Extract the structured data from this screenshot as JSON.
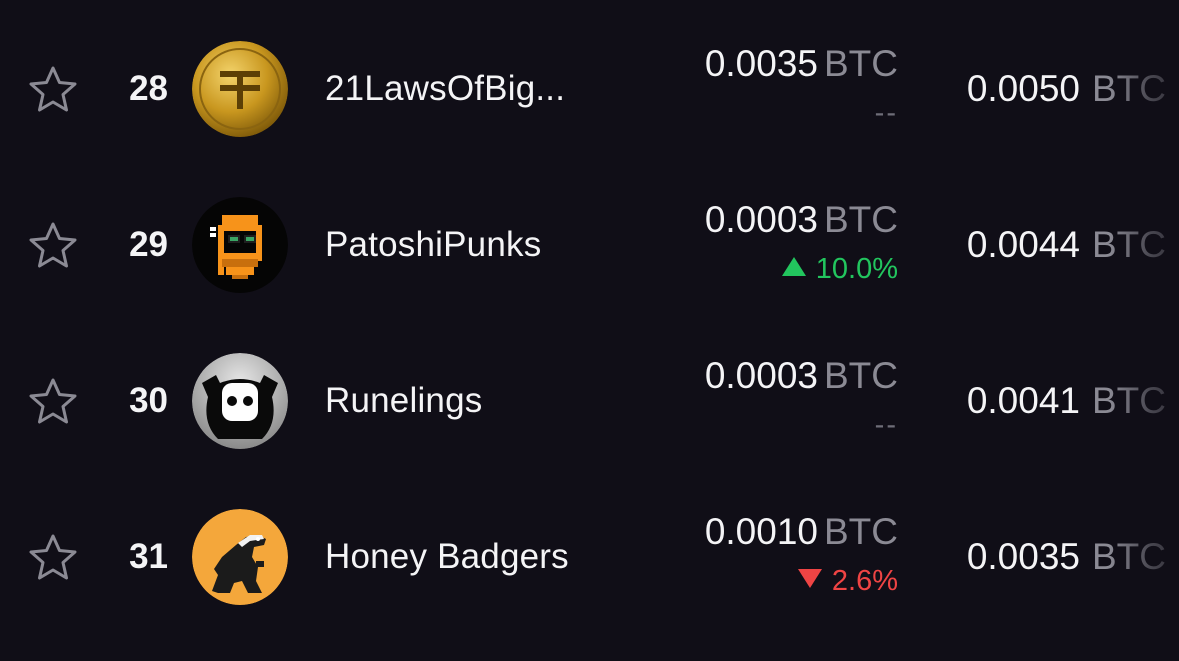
{
  "rows": [
    {
      "rank": "28",
      "name": "21LawsOfBig...",
      "floor_price": "0.0035",
      "floor_unit": "BTC",
      "change": "--",
      "change_direction": "neutral",
      "volume": "0.0050",
      "volume_unit": "BTC",
      "avatar_icon": "gold-coin-tether-icon"
    },
    {
      "rank": "29",
      "name": "PatoshiPunks",
      "floor_price": "0.0003",
      "floor_unit": "BTC",
      "change": "10.0%",
      "change_direction": "up",
      "volume": "0.0044",
      "volume_unit": "BTC",
      "avatar_icon": "pixel-punk-icon"
    },
    {
      "rank": "30",
      "name": "Runelings",
      "floor_price": "0.0003",
      "floor_unit": "BTC",
      "change": "--",
      "change_direction": "neutral",
      "volume": "0.0041",
      "volume_unit": "BTC",
      "avatar_icon": "runeling-creature-icon"
    },
    {
      "rank": "31",
      "name": "Honey Badgers",
      "floor_price": "0.0010",
      "floor_unit": "BTC",
      "change": "2.6%",
      "change_direction": "down",
      "volume": "0.0035",
      "volume_unit": "BTC",
      "avatar_icon": "honey-badger-icon"
    }
  ],
  "colors": {
    "background": "#100e17",
    "text": "#f4f4f6",
    "muted": "#8b8a94",
    "up": "#22c55e",
    "down": "#ef4444"
  }
}
